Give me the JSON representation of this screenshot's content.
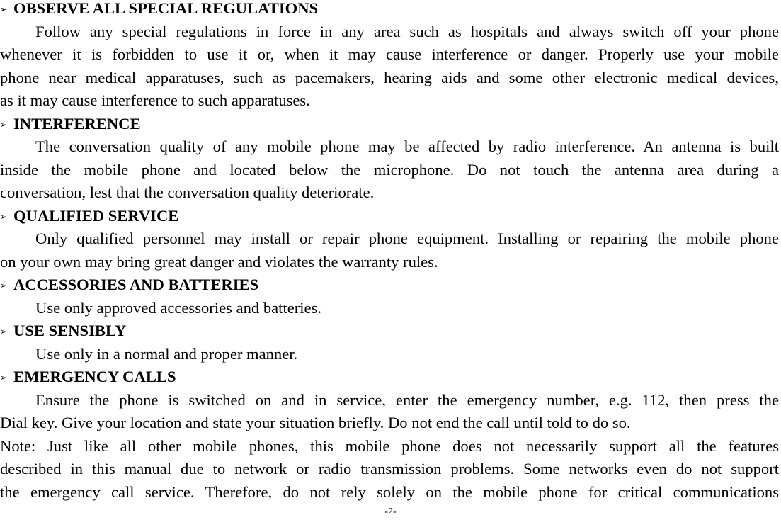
{
  "sections": [
    {
      "heading": "OBSERVE ALL SPECIAL REGULATIONS",
      "lines": [
        "Follow any special regulations in force in any area such as hospitals and always switch off your phone",
        "whenever it is forbidden to use it or, when it may cause interference or danger. Properly use your mobile",
        "phone near medical apparatuses, such as pacemakers, hearing aids and some other electronic medical devices,",
        "as it may cause interference to such apparatuses."
      ]
    },
    {
      "heading": "INTERFERENCE",
      "lines": [
        "The conversation quality of any mobile phone may be affected by radio interference. An antenna is built",
        "inside the mobile phone and located below the microphone. Do not touch the antenna area during a",
        "conversation, lest that the conversation quality deteriorate."
      ]
    },
    {
      "heading": "QUALIFIED SERVICE",
      "lines": [
        "Only qualified personnel may install or repair phone equipment. Installing or repairing the mobile phone",
        "on your own may bring great danger and violates the warranty rules."
      ]
    },
    {
      "heading": "ACCESSORIES AND BATTERIES",
      "lines": [
        "Use only approved accessories and batteries."
      ]
    },
    {
      "heading": "USE SENSIBLY",
      "lines": [
        "Use only in a normal and proper manner."
      ]
    },
    {
      "heading": "EMERGENCY CALLS",
      "lines": [
        "Ensure the phone is switched on and in service, enter the emergency number, e.g. 112, then press the",
        "Dial key. Give your location and state your situation briefly. Do not end the call until told to do so."
      ]
    }
  ],
  "note": {
    "lines": [
      "Note: Just like all other mobile phones, this mobile phone does not necessarily support all the features",
      "described in this manual due to network or radio transmission problems. Some networks even do not support",
      "the emergency call service. Therefore, do not rely solely on the mobile phone for critical communications"
    ]
  },
  "bullet_icon": "arrowhead-bullet-icon",
  "bullet_glyph": "➢",
  "page_number": "-2-"
}
